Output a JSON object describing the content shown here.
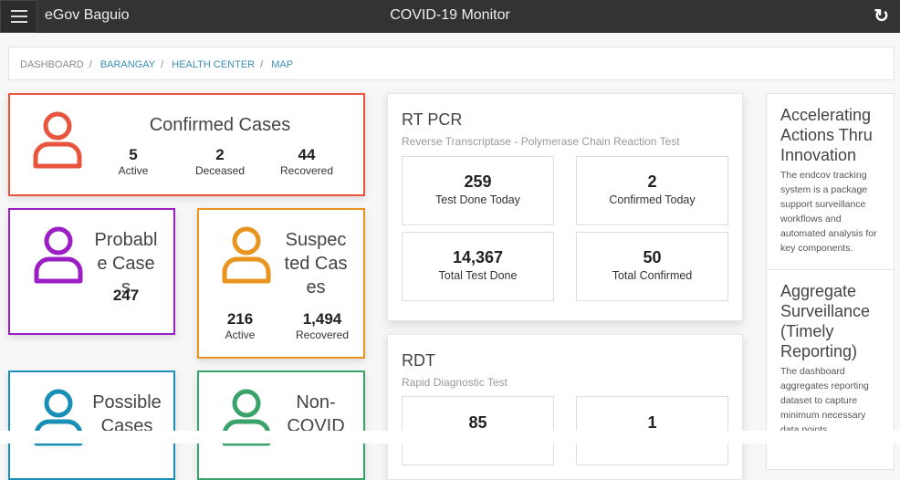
{
  "header": {
    "brand": "eGov Baguio",
    "title": "COVID-19 Monitor",
    "refresh_icon": "refresh-icon"
  },
  "breadcrumb": [
    "DASHBOARD",
    "BARANGAY",
    "HEALTH CENTER",
    "MAP"
  ],
  "confirmed": {
    "title": "Confirmed Cases",
    "color": "#e8553e",
    "stats": [
      {
        "value": "5",
        "label": "Active"
      },
      {
        "value": "2",
        "label": "Deceased"
      },
      {
        "value": "44",
        "label": "Recovered"
      }
    ]
  },
  "probable": {
    "title": "Probable Cases",
    "color": "#9b1fc4",
    "value": "247"
  },
  "suspected": {
    "title": "Suspected Cases",
    "color": "#e8941f",
    "stats": [
      {
        "value": "216",
        "label": "Active"
      },
      {
        "value": "1,494",
        "label": "Recovered"
      }
    ]
  },
  "possible": {
    "title": "Possible Cases",
    "color": "#1a8fb5"
  },
  "noncovid": {
    "title": "Non-COVID",
    "color": "#3aa36a"
  },
  "rtpcr": {
    "title": "RT PCR",
    "subtitle": "Reverse Transcriptase - Polymerase Chain Reaction Test",
    "stats": [
      {
        "value": "259",
        "label": "Test Done Today"
      },
      {
        "value": "2",
        "label": "Confirmed Today"
      },
      {
        "value": "14,367",
        "label": "Total Test Done"
      },
      {
        "value": "50",
        "label": "Total Confirmed"
      }
    ]
  },
  "rdt": {
    "title": "RDT",
    "subtitle": "Rapid Diagnostic Test",
    "stats": [
      {
        "value": "85"
      },
      {
        "value": "1"
      }
    ]
  },
  "info": [
    {
      "title": "Accelerating Actions Thru Innovation",
      "text": "The endcov tracking system is a package support surveillance workflows and automated analysis for key components."
    },
    {
      "title": "Aggregate Surveillance (Timely Reporting)",
      "text": "The dashboard aggregates reporting dataset to capture minimum necessary data points."
    }
  ]
}
